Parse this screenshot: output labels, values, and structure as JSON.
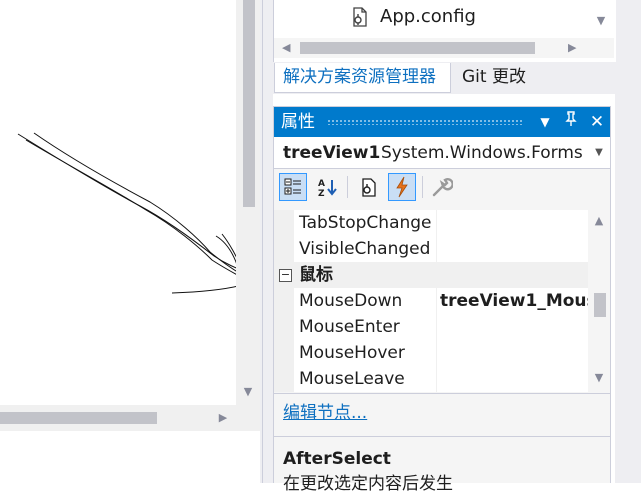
{
  "solution_explorer": {
    "file_item": "App.config",
    "tabs": [
      "解决方案资源管理器",
      "Git 更改"
    ]
  },
  "properties": {
    "title": "属性",
    "object_name": "treeView1",
    "object_type": "System.Windows.Forms",
    "rows": [
      {
        "name": "TabStopChange",
        "value": ""
      },
      {
        "name": "VisibleChanged",
        "value": ""
      }
    ],
    "category": "鼠标",
    "category_rows": [
      {
        "name": "MouseDown",
        "value": "treeView1_Mous"
      },
      {
        "name": "MouseEnter",
        "value": ""
      },
      {
        "name": "MouseHover",
        "value": ""
      },
      {
        "name": "MouseLeave",
        "value": ""
      }
    ],
    "edit_link": "编辑节点...",
    "description_title": "AfterSelect",
    "description_text": "在更改选定内容后发生"
  },
  "icons": {
    "file": "config-file-icon",
    "categorized": "categorized-icon",
    "alphabetical": "alphabetical-icon",
    "properties": "properties-icon",
    "events": "lightning-icon",
    "property_pages": "wrench-icon"
  },
  "colors": {
    "accent": "#007acc",
    "link": "#0e70c0",
    "events_orange": "#e8731c"
  }
}
